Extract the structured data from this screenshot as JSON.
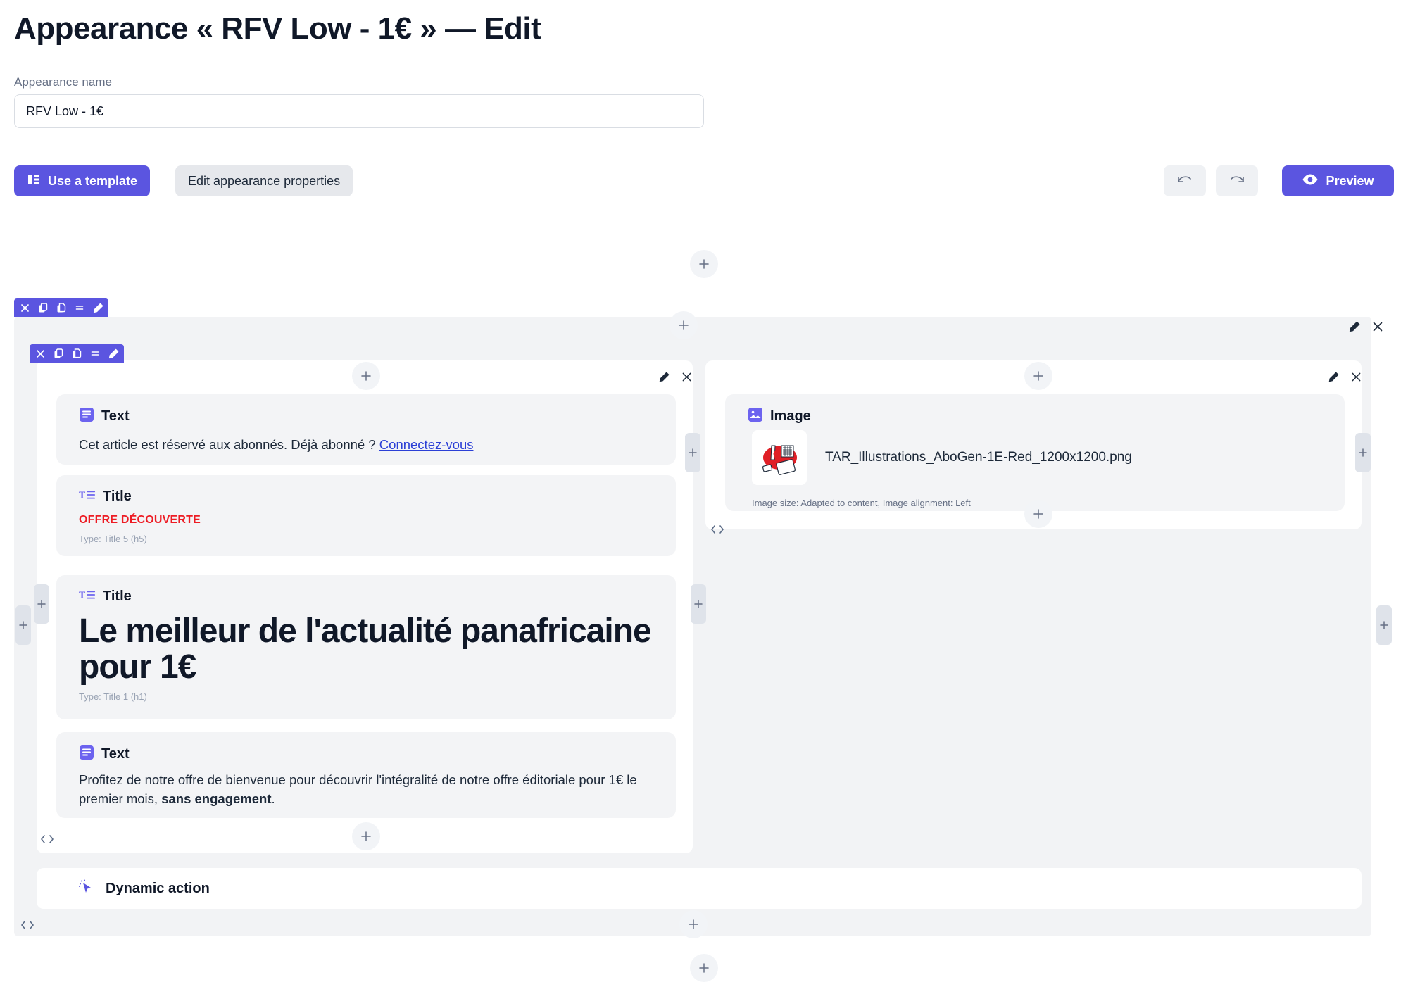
{
  "header": {
    "title": "Appearance « RFV Low - 1€ » — Edit",
    "name_label": "Appearance name",
    "name_value": "RFV Low - 1€",
    "name_placeholder": "Appearance name"
  },
  "toolbar": {
    "use_template_label": "Use a template",
    "edit_properties_label": "Edit appearance properties",
    "preview_label": "Preview",
    "undo_name": "undo",
    "redo_name": "redo"
  },
  "block_toolbar": {
    "close": "×",
    "duplicate": "duplicate",
    "copy": "copy",
    "move": "=",
    "edit": "edit"
  },
  "blocks": {
    "text_1": {
      "type_label": "Text",
      "content_prefix": "Cet article est réservé aux abonnés. Déjà abonné ? ",
      "link_text": "Connectez-vous"
    },
    "title_1": {
      "type_label": "Title",
      "content": "OFFRE DÉCOUVERTE",
      "meta": "Type: Title 5 (h5)",
      "color": "#ed1c24"
    },
    "title_2": {
      "type_label": "Title",
      "content": "Le meilleur de l'actualité panafricaine pour 1€",
      "meta": "Type: Title 1 (h1)"
    },
    "text_2": {
      "type_label": "Text",
      "content_part1": "Profitez de notre offre de bienvenue pour découvrir l'intégralité de notre offre éditoriale pour 1€ le premier mois, ",
      "content_bold": "sans engagement",
      "content_part3": "."
    },
    "image_1": {
      "type_label": "Image",
      "filename": "TAR_Illustrations_AboGen-1E-Red_1200x1200.png",
      "meta": "Image size: Adapted to content, Image alignment: Left"
    },
    "dynamic_action": {
      "label": "Dynamic action"
    }
  },
  "icons": {
    "add": "+",
    "code": "<>",
    "text_block": "text-block-icon",
    "title_block": "title-block-icon",
    "image_block": "image-block-icon",
    "cursor": "cursor-icon"
  },
  "colors": {
    "accent": "#5b55e0",
    "danger": "#ed1c24",
    "link": "#2b3fd6",
    "canvas": "#f2f3f5",
    "card": "#f3f4f6"
  }
}
